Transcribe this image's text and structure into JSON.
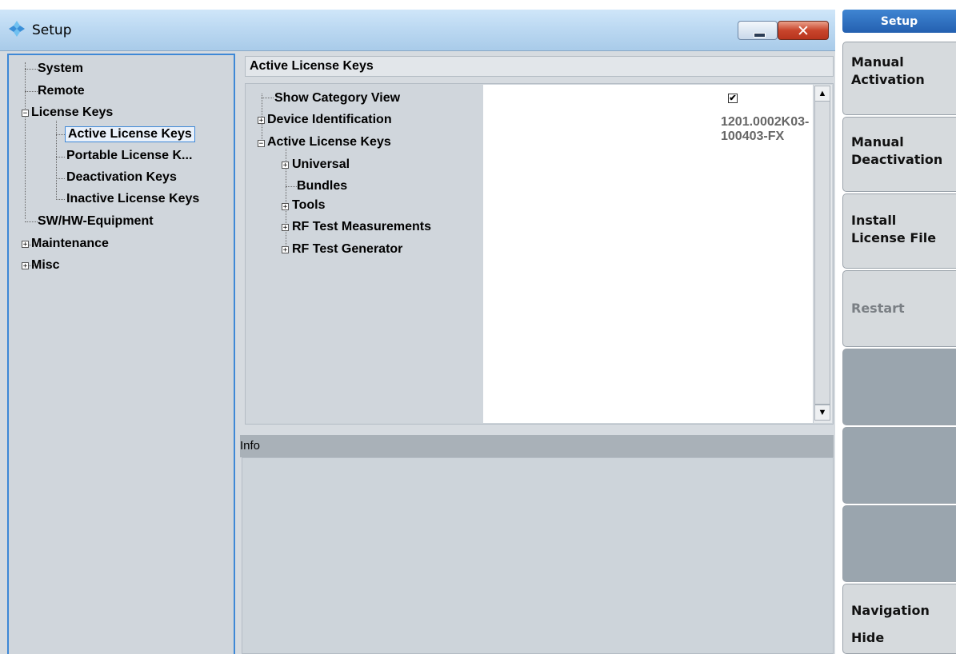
{
  "window": {
    "title": "Setup"
  },
  "left_tree": {
    "items": [
      {
        "label": "System"
      },
      {
        "label": "Remote"
      },
      {
        "label": "License Keys"
      },
      {
        "label": "Active License Keys"
      },
      {
        "label": "Portable License K..."
      },
      {
        "label": "Deactivation Keys"
      },
      {
        "label": "Inactive License Keys"
      },
      {
        "label": "SW/HW-Equipment"
      },
      {
        "label": "Maintenance"
      },
      {
        "label": "Misc"
      }
    ]
  },
  "panel": {
    "title": "Active License Keys",
    "tree": [
      {
        "label": "Show Category View"
      },
      {
        "label": "Device Identification"
      },
      {
        "label": "Active License Keys"
      },
      {
        "label": "Universal"
      },
      {
        "label": "Bundles"
      },
      {
        "label": "Tools"
      },
      {
        "label": "RF Test Measurements"
      },
      {
        "label": "RF Test Generator"
      }
    ],
    "show_category_view_checked": true,
    "checkbox_mark": "✔",
    "device_id": "1201.0002K03-100403-FX"
  },
  "info": {
    "label": "Info"
  },
  "softkeys": {
    "header": "Setup",
    "keys": [
      {
        "line1": "Manual",
        "line2": "Activation"
      },
      {
        "line1": "Manual",
        "line2": "Deactivation"
      },
      {
        "line1": "Install",
        "line2": "License File"
      },
      {
        "line1": "Restart",
        "line2": ""
      },
      {
        "line1": "",
        "line2": ""
      },
      {
        "line1": "",
        "line2": ""
      },
      {
        "line1": "",
        "line2": ""
      },
      {
        "line1": "Navigation",
        "line2": "Hide"
      }
    ]
  },
  "icons": {
    "app": "setup-diamond-icon",
    "minimize": "minimize-icon",
    "close": "close-icon",
    "close_glyph": "✕",
    "collapse_glyph": "−",
    "expand_glyph": "+",
    "scroll_up": "▲",
    "scroll_down": "▼"
  },
  "colors": {
    "accent": "#3e88d6",
    "softkey_header": "#2460b0",
    "close_button": "#c8452c"
  }
}
